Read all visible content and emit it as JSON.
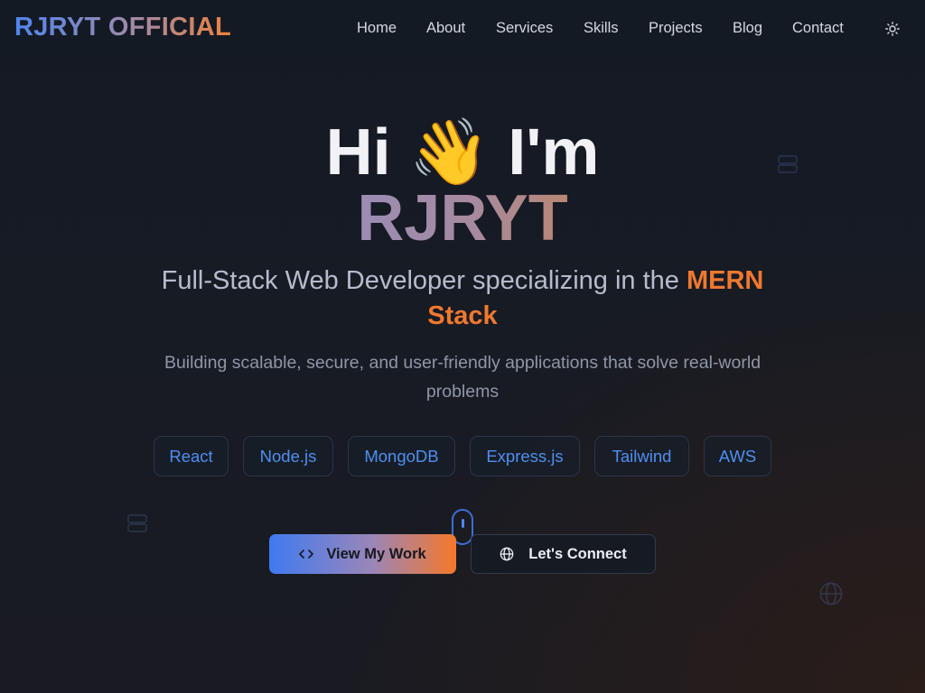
{
  "brand": {
    "name_part1": "RJRYT",
    "name_part2": "OFFICIAL"
  },
  "nav": {
    "links": [
      "Home",
      "About",
      "Services",
      "Skills",
      "Projects",
      "Blog",
      "Contact"
    ]
  },
  "hero": {
    "greeting_hi": "Hi",
    "wave_emoji": "👋",
    "greeting_im": "I'm",
    "name": "RJRYT",
    "subtitle_prefix": "Full-Stack Web Developer specializing in the",
    "subtitle_accent": "MERN Stack",
    "description": "Building scalable, secure, and user-friendly applications that solve real-world problems"
  },
  "tech_pills": [
    "React",
    "Node.js",
    "MongoDB",
    "Express.js",
    "Tailwind",
    "AWS"
  ],
  "buttons": {
    "primary_label": "View My Work",
    "secondary_label": "Let's Connect"
  },
  "colors": {
    "accent_blue": "#4f8ff0",
    "accent_orange": "#f0782e",
    "background": "#171b24"
  },
  "icons": {
    "theme_toggle": "sun-icon",
    "primary_button": "code-icon",
    "secondary_button": "globe-icon",
    "scroll_indicator": "mouse-icon"
  }
}
